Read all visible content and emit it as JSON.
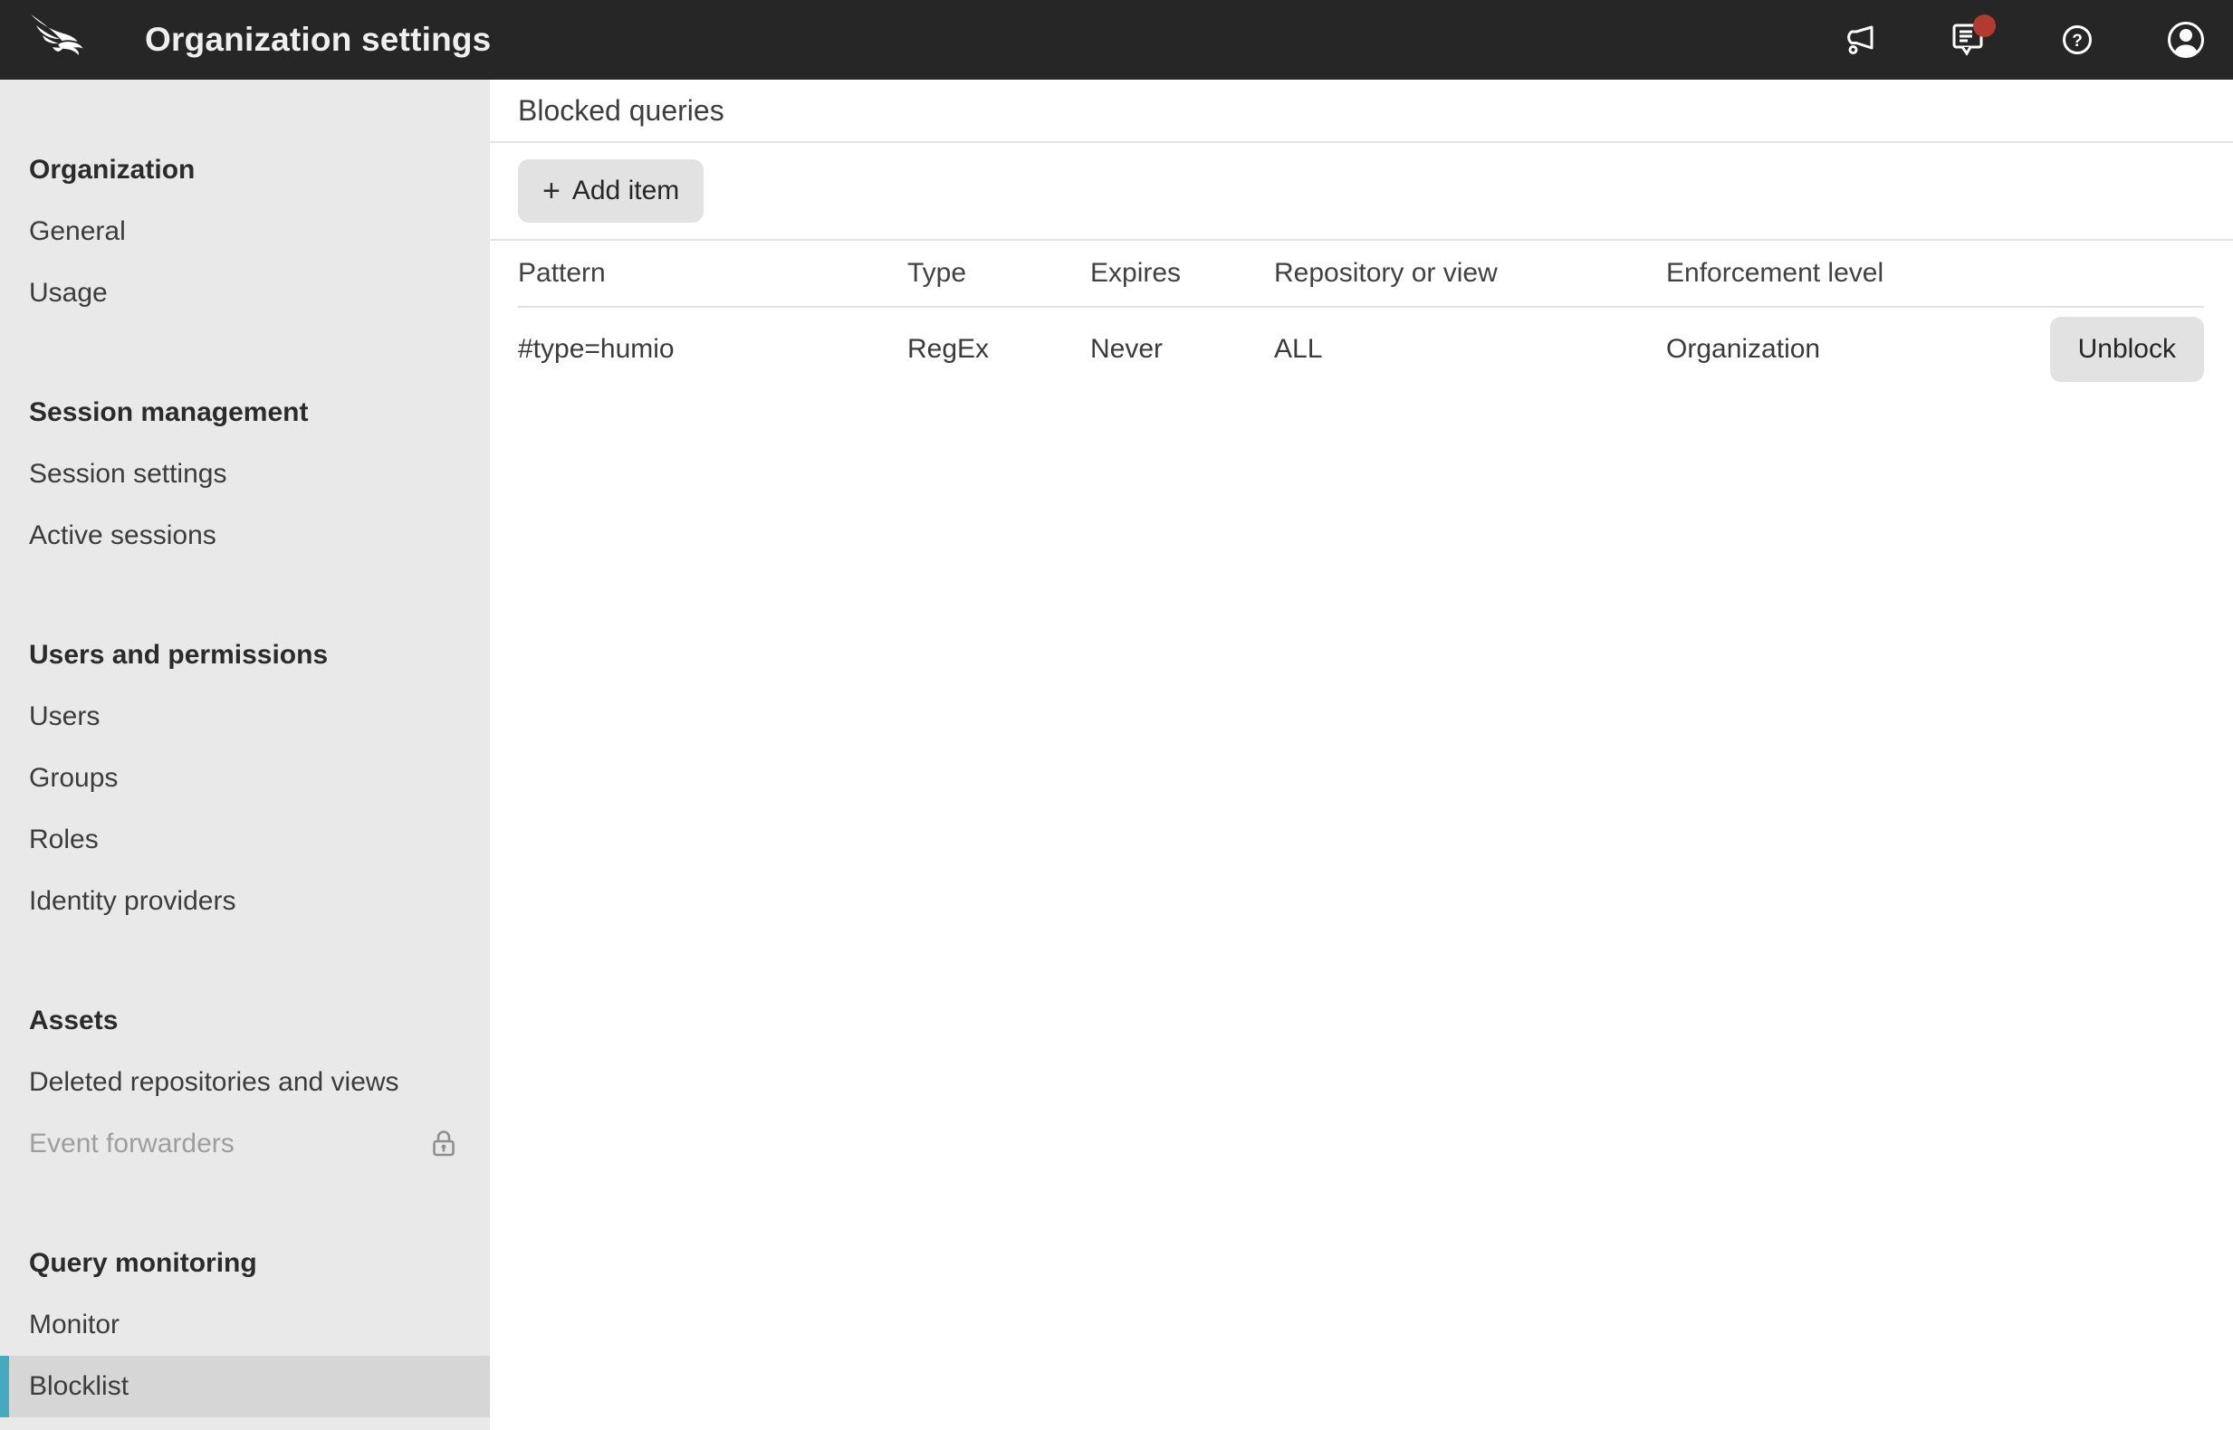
{
  "colors": {
    "header_bg": "#262626",
    "accent_teal": "#47a9bc",
    "badge_red": "#b23a31",
    "sidebar_bg": "#e9e9e9",
    "selected_bg": "#d6d6d6",
    "divider": "#e0e0e0",
    "button_bg": "#e2e2e2"
  },
  "header": {
    "title": "Organization settings",
    "help_glyph": "?",
    "icons": [
      "megaphone-icon",
      "chat-icon",
      "help-icon",
      "avatar-icon"
    ],
    "notification_badge": true
  },
  "sidebar": {
    "sections": [
      {
        "title": "Organization",
        "items": [
          {
            "label": "General"
          },
          {
            "label": "Usage"
          }
        ]
      },
      {
        "title": "Session management",
        "items": [
          {
            "label": "Session settings"
          },
          {
            "label": "Active sessions"
          }
        ]
      },
      {
        "title": "Users and permissions",
        "items": [
          {
            "label": "Users"
          },
          {
            "label": "Groups"
          },
          {
            "label": "Roles"
          },
          {
            "label": "Identity providers"
          }
        ]
      },
      {
        "title": "Assets",
        "items": [
          {
            "label": "Deleted repositories and views"
          },
          {
            "label": "Event forwarders",
            "locked": true
          }
        ]
      },
      {
        "title": "Query monitoring",
        "items": [
          {
            "label": "Monitor"
          },
          {
            "label": "Blocklist",
            "selected": true
          }
        ]
      }
    ]
  },
  "main": {
    "page_title": "Blocked queries",
    "add_item": {
      "plus": "+",
      "label": "Add item"
    },
    "table": {
      "columns": [
        "Pattern",
        "Type",
        "Expires",
        "Repository or view",
        "Enforcement level"
      ],
      "rows": [
        {
          "pattern": "#type=humio",
          "type": "RegEx",
          "expires": "Never",
          "repository": "ALL",
          "enforcement": "Organization",
          "action": "Unblock"
        }
      ]
    }
  }
}
